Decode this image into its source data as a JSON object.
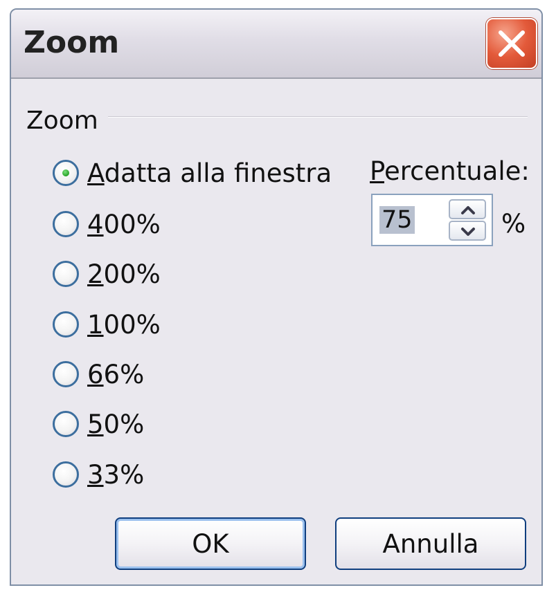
{
  "window": {
    "title": "Zoom",
    "close_icon": "close-icon"
  },
  "group": {
    "label": "Zoom"
  },
  "options": [
    {
      "mnemonic": "A",
      "rest": "datta alla finestra",
      "selected": true
    },
    {
      "mnemonic": "4",
      "rest": "00%",
      "selected": false
    },
    {
      "mnemonic": "2",
      "rest": "00%",
      "selected": false
    },
    {
      "mnemonic": "1",
      "rest": "00%",
      "selected": false
    },
    {
      "mnemonic": "6",
      "rest": "6%",
      "selected": false
    },
    {
      "mnemonic": "5",
      "rest": "0%",
      "selected": false
    },
    {
      "mnemonic": "3",
      "rest": "3%",
      "selected": false
    }
  ],
  "percent": {
    "label_mnemonic": "P",
    "label_rest": "ercentuale:",
    "value": "75",
    "unit": "%",
    "up_icon": "chevron-up-icon",
    "down_icon": "chevron-down-icon"
  },
  "buttons": {
    "ok": "OK",
    "cancel": "Annulla"
  },
  "colors": {
    "selected_radio": "#27a327",
    "default_button_border": "#0f3e7e",
    "close_button": "#e35a3a"
  }
}
